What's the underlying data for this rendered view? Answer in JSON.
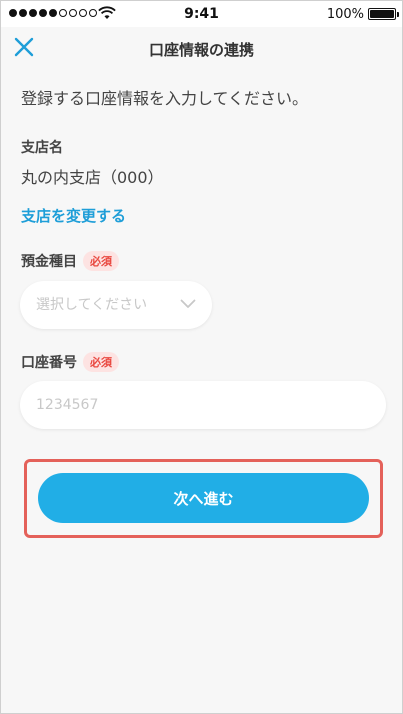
{
  "status_bar": {
    "time": "9:41",
    "battery": "100%",
    "signal_dots": [
      true,
      true,
      true,
      true,
      true,
      false,
      false,
      false,
      false
    ]
  },
  "nav": {
    "title": "口座情報の連携",
    "close_icon": "close-icon"
  },
  "instruction": "登録する口座情報を入力してください。",
  "branch": {
    "label": "支店名",
    "value": "丸の内支店（000）",
    "change_link": "支店を変更する"
  },
  "deposit_type": {
    "label": "預金種目",
    "required": "必須",
    "placeholder": "選択してください"
  },
  "account_number": {
    "label": "口座番号",
    "required": "必須",
    "placeholder": "1234567"
  },
  "next_button": "次へ進む",
  "colors": {
    "accent": "#21aee6",
    "link": "#1e9ed8",
    "required_text": "#e9473f",
    "required_bg": "#fde3e2",
    "highlight": "#e4615a"
  }
}
